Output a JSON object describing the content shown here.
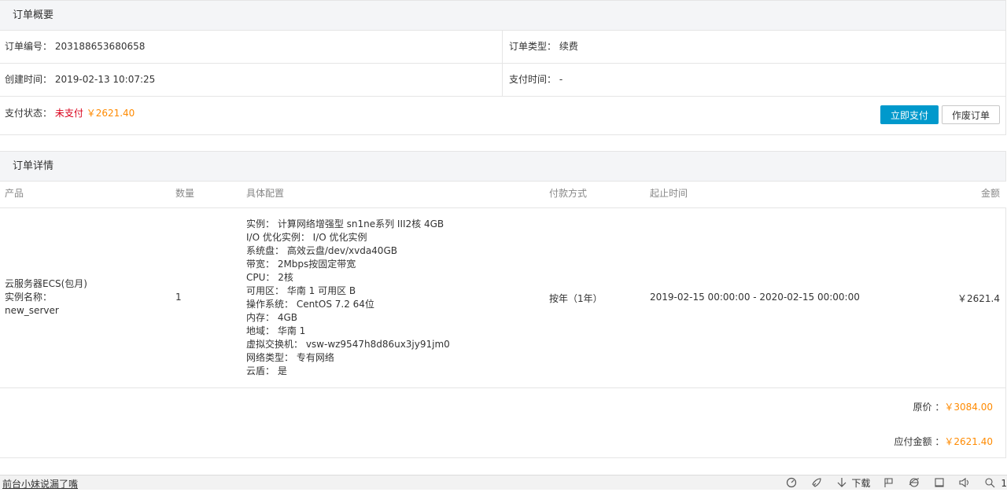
{
  "summary": {
    "title": "订单概要",
    "order_no_label": "订单编号：",
    "order_no": "203188653680658",
    "order_type_label": "订单类型：",
    "order_type": "续费",
    "created_label": "创建时间：",
    "created": "2019-02-13 10:07:25",
    "paid_label": "支付时间：",
    "paid": "-",
    "status_label": "支付状态：",
    "status": "未支付",
    "status_amount": "￥2621.40",
    "pay_button": "立即支付",
    "cancel_button": "作废订单"
  },
  "detail": {
    "title": "订单详情",
    "headers": {
      "product": "产品",
      "qty": "数量",
      "config": "具体配置",
      "payment": "付款方式",
      "period": "起止时间",
      "amount": "金额"
    },
    "row": {
      "product_lines": [
        "云服务器ECS(包月)",
        "实例名称：",
        "new_server"
      ],
      "qty": "1",
      "config_lines": [
        "实例： 计算网络增强型 sn1ne系列 III2核 4GB",
        "I/O 优化实例： I/O 优化实例",
        "系统盘： 高效云盘/dev/xvda40GB",
        "带宽： 2Mbps按固定带宽",
        "CPU： 2核",
        "可用区： 华南 1 可用区 B",
        "操作系统： CentOS 7.2 64位",
        "内存： 4GB",
        "地域： 华南 1",
        "虚拟交换机： vsw-wz9547h8d86ux3jy91jm0",
        "网络类型： 专有网络",
        "云盾： 是"
      ],
      "payment": "按年（1年）",
      "period": "2019-02-15 00:00:00 - 2020-02-15 00:00:00",
      "amount": "￥2621.4"
    },
    "original_label": "原价 ：",
    "original_price": "￥3084.00",
    "due_label": "应付金额 ：",
    "due_amount": "￥2621.40"
  },
  "statusbar": {
    "left_text": "前台小妹说漏了嘴",
    "download_label": "下载",
    "icons": [
      "speed-icon",
      "rocket-icon",
      "download-icon",
      "flag-icon",
      "ie-icon",
      "window-icon",
      "volume-icon",
      "zoom-icon"
    ],
    "trailing": "1"
  }
}
